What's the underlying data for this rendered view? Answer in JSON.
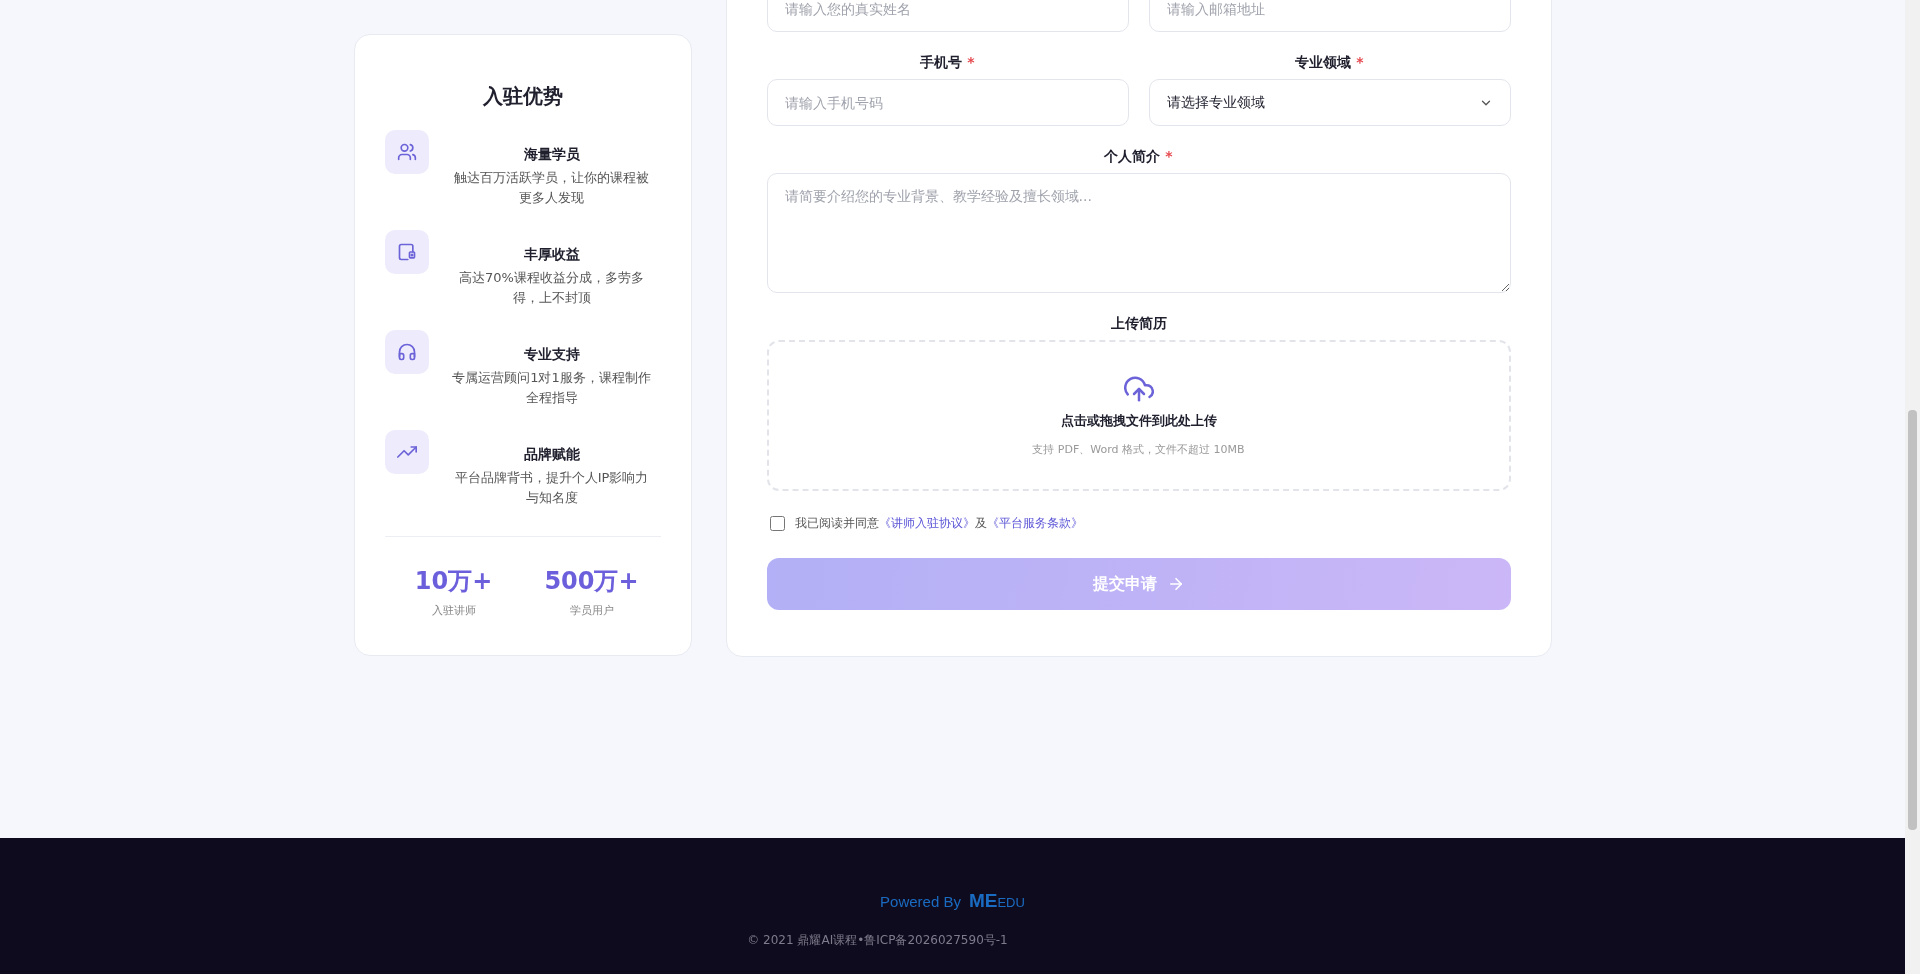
{
  "benefits_card": {
    "title": "入驻优势",
    "items": [
      {
        "title": "海量学员",
        "description": "触达百万活跃学员，让你的课程被更多人发现",
        "kind": "users"
      },
      {
        "title": "丰厚收益",
        "description": "高达70%课程收益分成，多劳多得，上不封顶",
        "kind": "wallet"
      },
      {
        "title": "专业支持",
        "description": "专属运营顾问1对1服务，课程制作全程指导",
        "kind": "headset"
      },
      {
        "title": "品牌赋能",
        "description": "平台品牌背书，提升个人IP影响力与知名度",
        "kind": "trend"
      }
    ],
    "stats": [
      {
        "value": "10万+",
        "label": "入驻讲师"
      },
      {
        "value": "500万+",
        "label": "学员用户"
      }
    ]
  },
  "form": {
    "fields": [
      {
        "kind": "input",
        "placeholder": "请输入您的真实姓名"
      },
      {
        "kind": "input",
        "placeholder": "请输入邮箱地址"
      },
      {
        "kind": "input",
        "label": "手机号",
        "mark": "*",
        "placeholder": "请输入手机号码"
      },
      {
        "kind": "select",
        "label": "专业领域",
        "mark": "*",
        "value": "请选择专业领域"
      },
      {
        "kind": "textarea",
        "label": "个人简介",
        "mark": "*",
        "placeholder": "请简要介绍您的专业背景、教学经验及擅长领域..."
      }
    ],
    "upload": {
      "label": "上传简历",
      "title": "点击或拖拽文件到此处上传",
      "hint": "支持 PDF、Word 格式，文件不超过 10MB"
    },
    "agreement": {
      "checked": false,
      "text": "我已阅读并同意",
      "link_1": "《讲师入驻协议》",
      "joiner": "及",
      "link_2": "《平台服务条款》"
    },
    "submit": {
      "label": "提交申请",
      "disabled": true
    }
  },
  "footer": {
    "powered_by": "Powered By",
    "logo_main": "ME",
    "logo_sub": "EDU",
    "copyright": "© 2021 鼎耀AI课程•鲁ICP备2026027590号-1"
  }
}
